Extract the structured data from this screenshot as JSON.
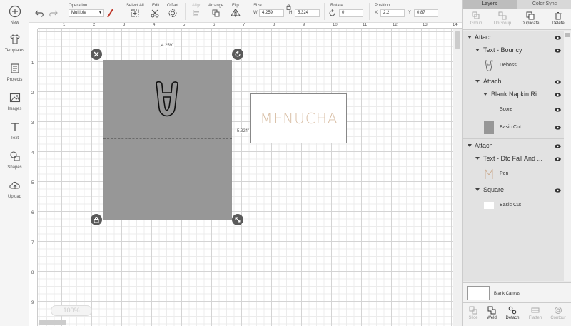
{
  "nav": [
    {
      "label": "New",
      "icon": "plus-circle-icon"
    },
    {
      "label": "Templates",
      "icon": "shirt-icon"
    },
    {
      "label": "Projects",
      "icon": "projects-icon"
    },
    {
      "label": "Images",
      "icon": "image-icon"
    },
    {
      "label": "Text",
      "icon": "text-icon"
    },
    {
      "label": "Shapes",
      "icon": "shapes-icon"
    },
    {
      "label": "Upload",
      "icon": "upload-cloud-icon"
    }
  ],
  "toolbar": {
    "operation_label": "Operation",
    "operation_value": "Multiple",
    "select_all_label": "Select All",
    "edit_label": "Edit",
    "offset_label": "Offset",
    "align_label": "Align",
    "arrange_label": "Arrange",
    "flip_label": "Flip",
    "size_label": "Size",
    "w_label": "W",
    "w_value": "4.259",
    "h_label": "H",
    "h_value": "5.324",
    "rotate_label": "Rotate",
    "rotate_value": "0",
    "position_label": "Position",
    "x_label": "X",
    "x_value": "2.2",
    "y_label": "Y",
    "y_value": "0.87",
    "accent_color": "#c0392b"
  },
  "canvas": {
    "ruler_top": [
      "1",
      "2",
      "3",
      "4",
      "5",
      "6",
      "7",
      "8",
      "9",
      "10",
      "11",
      "12",
      "13",
      "14"
    ],
    "ruler_left": [
      "1",
      "2",
      "3",
      "4",
      "5",
      "6",
      "7",
      "8",
      "9"
    ],
    "width_dim": "4.259\"",
    "height_dim": "5.324\"",
    "menucha_text": "MENUCHA",
    "zoom": "100%",
    "napkin_color": "#979797",
    "menucha_color": "#d9bfa6"
  },
  "right_panel": {
    "tab_layers": "Layers",
    "tab_color_sync": "Color Sync",
    "actions": [
      {
        "label": "Group",
        "enabled": false
      },
      {
        "label": "UnGroup",
        "enabled": false
      },
      {
        "label": "Duplicate",
        "enabled": true
      },
      {
        "label": "Delete",
        "enabled": true
      }
    ],
    "layers": {
      "attach1": "Attach",
      "text_bouncy": "Text - Bouncy",
      "deboss": "Deboss",
      "attach2": "Attach",
      "blank_napkin": "Blank Napkin Ri...",
      "score": "Score",
      "basic_cut_1": "Basic Cut",
      "attach3": "Attach",
      "text_dtc": "Text - Dtc Fall And ...",
      "pen": "Pen",
      "square": "Square",
      "basic_cut_2": "Basic Cut"
    },
    "blank_canvas": "Blank Canvas",
    "bottom_tools": [
      {
        "label": "Slice",
        "enabled": false
      },
      {
        "label": "Weld",
        "enabled": true
      },
      {
        "label": "Detach",
        "enabled": true
      },
      {
        "label": "Flatten",
        "enabled": false
      },
      {
        "label": "Contour",
        "enabled": false
      }
    ]
  }
}
